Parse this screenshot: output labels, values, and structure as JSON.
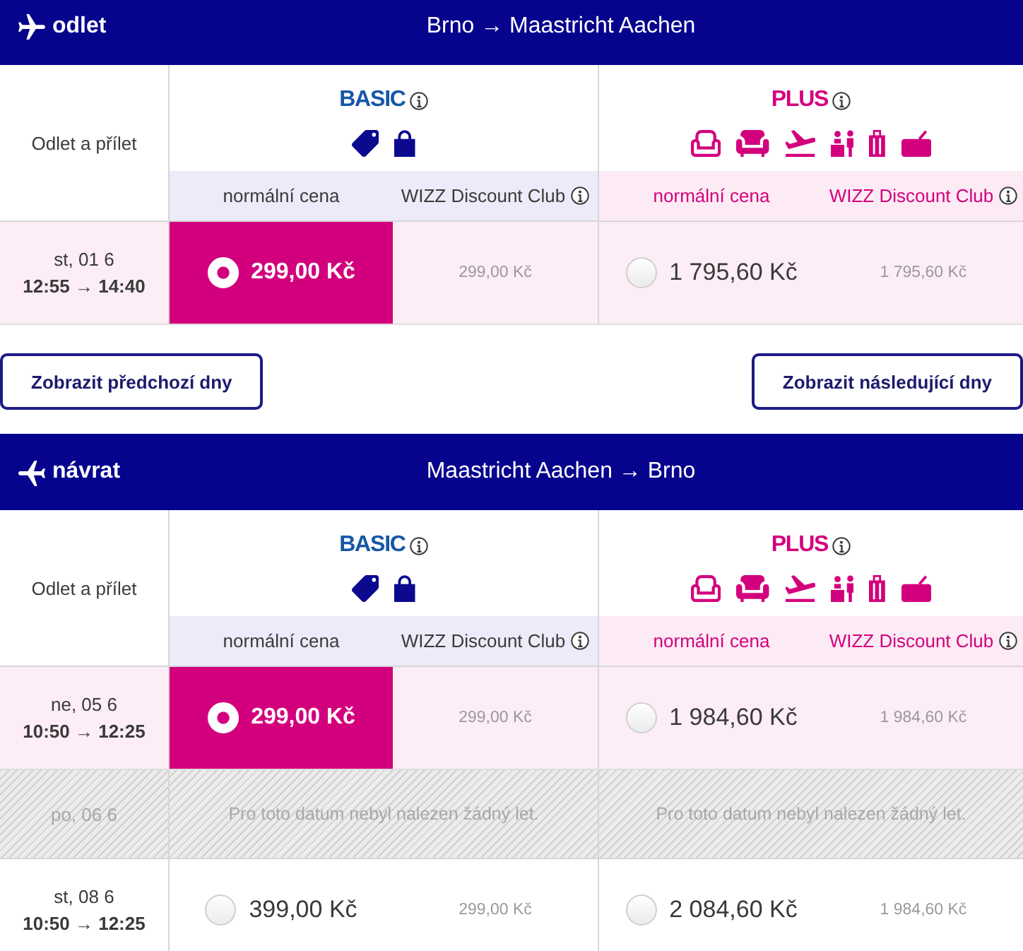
{
  "sections": [
    {
      "kind": "outbound",
      "direction": "odlet",
      "route": "Brno → Maastricht Aachen",
      "table": {
        "heading": "Odlet a přílet",
        "fares": [
          {
            "name": "BASIC",
            "kind": "basic",
            "info": true,
            "columns": [
              {
                "label": "normální cena",
                "info": false
              },
              {
                "label": "WIZZ Discount Club",
                "info": true
              }
            ]
          },
          {
            "name": "PLUS",
            "kind": "plus",
            "info": true,
            "columns": [
              {
                "label": "normální cena",
                "info": false
              },
              {
                "label": "WIZZ Discount Club",
                "info": true
              }
            ]
          }
        ],
        "rows": [
          {
            "kind": "flight",
            "selected": true,
            "date": "st, 01 6",
            "times": "12:55 → 14:40",
            "fares": [
              {
                "price": "299,00 Kč",
                "selected": true,
                "club_price": "299,00 Kč"
              },
              {
                "price": "1 795,60 Kč",
                "selected": false,
                "club_price": "1 795,60 Kč"
              }
            ]
          }
        ]
      },
      "buttons": [
        {
          "kind": "previous",
          "label": "Zobrazit předchozí dny"
        },
        {
          "kind": "next",
          "label": "Zobrazit následující dny"
        }
      ]
    },
    {
      "kind": "return",
      "direction": "návrat",
      "route": "Maastricht Aachen → Brno",
      "table": {
        "heading": "Odlet a přílet",
        "fares": [
          {
            "name": "BASIC",
            "kind": "basic",
            "info": true,
            "columns": [
              {
                "label": "normální cena",
                "info": false
              },
              {
                "label": "WIZZ Discount Club",
                "info": true
              }
            ]
          },
          {
            "name": "PLUS",
            "kind": "plus",
            "info": true,
            "columns": [
              {
                "label": "normální cena",
                "info": false
              },
              {
                "label": "WIZZ Discount Club",
                "info": true
              }
            ]
          }
        ],
        "rows": [
          {
            "kind": "flight",
            "selected": true,
            "date": "ne, 05 6",
            "times": "10:50 → 12:25",
            "fares": [
              {
                "price": "299,00 Kč",
                "selected": true,
                "club_price": "299,00 Kč"
              },
              {
                "price": "1 984,60 Kč",
                "selected": false,
                "club_price": "1 984,60 Kč"
              }
            ]
          },
          {
            "kind": "no_flight",
            "selected": false,
            "date": "po, 06 6",
            "messages": [
              "Pro toto datum nebyl nalezen žádný let.",
              "Pro toto datum nebyl nalezen žádný let."
            ]
          },
          {
            "kind": "flight",
            "selected": false,
            "date": "st, 08 6",
            "times": "10:50 → 12:25",
            "fares": [
              {
                "price": "399,00 Kč",
                "selected": false,
                "club_price": "299,00 Kč"
              },
              {
                "price": "2 084,60 Kč",
                "selected": false,
                "club_price": "1 984,60 Kč"
              }
            ]
          }
        ]
      }
    }
  ]
}
